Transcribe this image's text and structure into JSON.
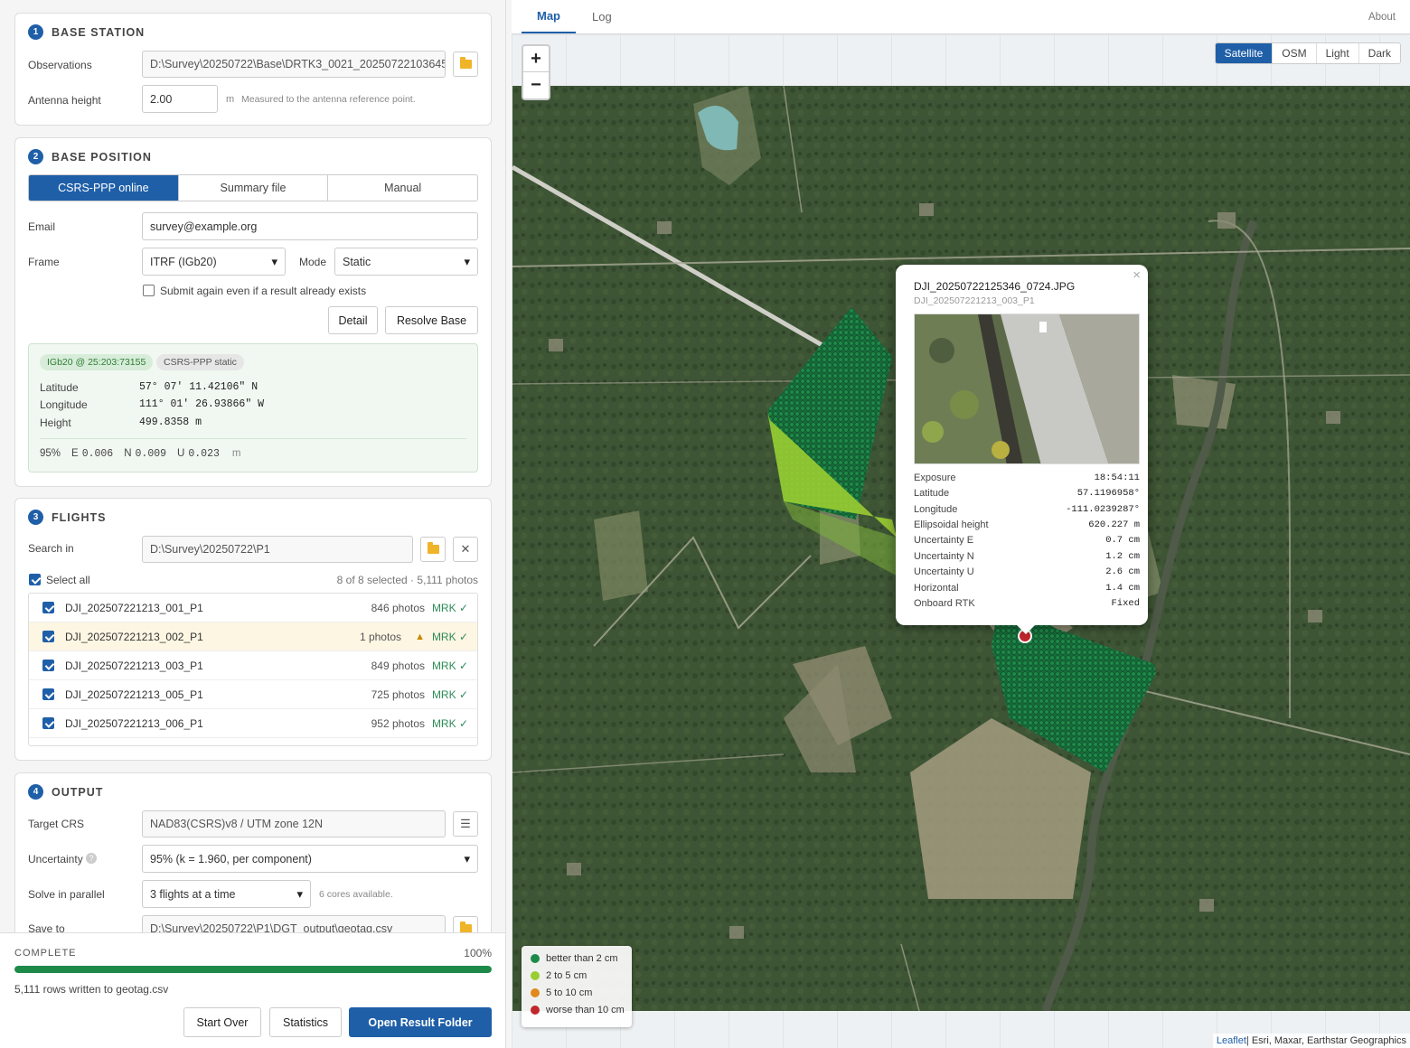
{
  "sections": {
    "base_station": {
      "number": "1",
      "title": "BASE STATION",
      "observations_label": "Observations",
      "observations_value": "D:\\Survey\\20250722\\Base\\DRTK3_0021_20250722103645",
      "antenna_label": "Antenna height",
      "antenna_value": "2.00",
      "antenna_unit": "m",
      "antenna_hint": "Measured to the antenna reference point."
    },
    "base_position": {
      "number": "2",
      "title": "BASE POSITION",
      "tabs": [
        "CSRS-PPP online",
        "Summary file",
        "Manual"
      ],
      "email_label": "Email",
      "email_value": "survey@example.org",
      "frame_label": "Frame",
      "frame_value": "ITRF (IGb20)",
      "mode_label": "Mode",
      "mode_value": "Static",
      "resubmit_label": "Submit again even if a result already exists",
      "detail_button": "Detail",
      "resolve_button": "Resolve Base",
      "result": {
        "tag_frame": "IGb20 @ 25:203:73155",
        "tag_method": "CSRS-PPP static",
        "latitude_label": "Latitude",
        "latitude_value": "57° 07' 11.42106\" N",
        "longitude_label": "Longitude",
        "longitude_value": "111° 01' 26.93866\" W",
        "height_label": "Height",
        "height_value": "499.8358 m",
        "confidence": "95%",
        "e_label": "E",
        "e_value": "0.006",
        "n_label": "N",
        "n_value": "0.009",
        "u_label": "U",
        "u_value": "0.023",
        "unit": "m"
      }
    },
    "flights": {
      "number": "3",
      "title": "FLIGHTS",
      "search_label": "Search in",
      "search_value": "D:\\Survey\\20250722\\P1",
      "select_all_label": "Select all",
      "selection_summary": "8 of 8 selected · 5,111 photos",
      "items": [
        {
          "name": "DJI_202507221213_001_P1",
          "count": "846 photos",
          "mrk": "MRK ✓"
        },
        {
          "name": "DJI_202507221213_002_P1",
          "count": "1 photos",
          "warning": "▲",
          "mrk": "MRK ✓"
        },
        {
          "name": "DJI_202507221213_003_P1",
          "count": "849 photos",
          "mrk": "MRK ✓"
        },
        {
          "name": "DJI_202507221213_005_P1",
          "count": "725 photos",
          "mrk": "MRK ✓"
        },
        {
          "name": "DJI_202507221213_006_P1",
          "count": "952 photos",
          "mrk": "MRK ✓"
        }
      ]
    },
    "output": {
      "number": "4",
      "title": "OUTPUT",
      "crs_label": "Target CRS",
      "crs_value": "NAD83(CSRS)v8 / UTM zone 12N",
      "uncertainty_label": "Uncertainty",
      "uncertainty_value": "95% (k = 1.960, per component)",
      "parallel_label": "Solve in parallel",
      "parallel_value": "3 flights at a time",
      "parallel_hint": "6 cores available.",
      "save_label": "Save to",
      "save_value": "D:\\Survey\\20250722\\P1\\DGT_output\\geotag.csv"
    }
  },
  "status": {
    "label": "COMPLETE",
    "percent": "100%",
    "progress": 1.0,
    "message": "5,111 rows written to geotag.csv",
    "start_over": "Start Over",
    "statistics": "Statistics",
    "open_folder": "Open Result Folder"
  },
  "map_panel": {
    "tabs": [
      "Map",
      "Log"
    ],
    "about": "About",
    "layers": [
      "Satellite",
      "OSM",
      "Light",
      "Dark"
    ],
    "zoom_in": "+",
    "zoom_out": "−",
    "popup": {
      "filename": "DJI_20250722125346_0724.JPG",
      "flight": "DJI_202507221213_003_P1",
      "rows": [
        {
          "label": "Exposure",
          "value": "18:54:11"
        },
        {
          "label": "Latitude",
          "value": "57.1196958°"
        },
        {
          "label": "Longitude",
          "value": "-111.0239287°"
        },
        {
          "label": "Ellipsoidal height",
          "value": "620.227 m"
        },
        {
          "label": "Uncertainty E",
          "value": "0.7 cm"
        },
        {
          "label": "Uncertainty N",
          "value": "1.2 cm"
        },
        {
          "label": "Uncertainty U",
          "value": "2.6 cm"
        },
        {
          "label": "Horizontal",
          "value": "1.4 cm"
        },
        {
          "label": "Onboard RTK",
          "value": "Fixed"
        }
      ]
    },
    "legend": [
      {
        "label": "better than 2 cm",
        "color": "#1e8a4a"
      },
      {
        "label": "2 to 5 cm",
        "color": "#9acd32"
      },
      {
        "label": "5 to 10 cm",
        "color": "#e08a1e"
      },
      {
        "label": "worse than 10 cm",
        "color": "#c0272d"
      }
    ],
    "attribution_link": "Leaflet",
    "attribution_text": " | Esri, Maxar, Earthstar Geographics"
  },
  "colors": {
    "accent": "#1f5fa8",
    "progress": "#1e8a4a",
    "mrk_ok": "#2e8b57"
  }
}
